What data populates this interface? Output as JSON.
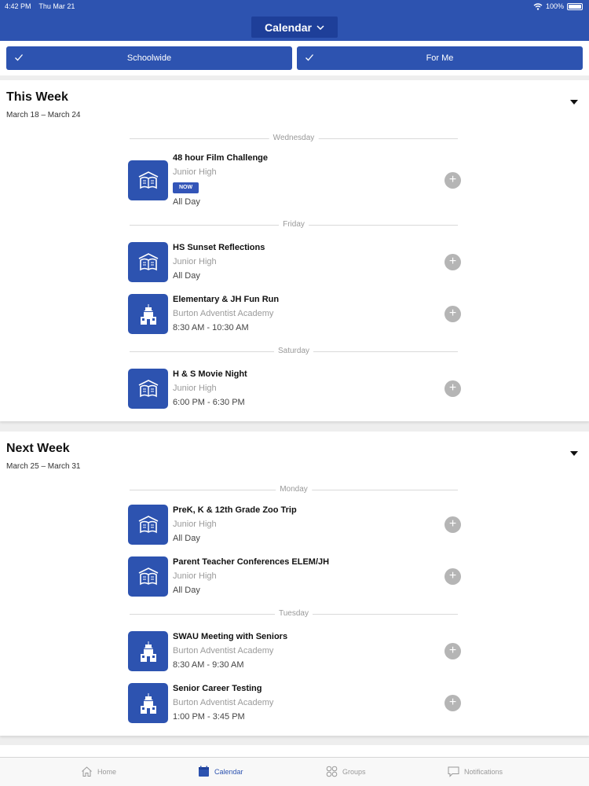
{
  "status_bar": {
    "time": "4:42 PM",
    "date": "Thu Mar 21",
    "battery": "100%",
    "battery_level": 1.0
  },
  "header": {
    "title": "Calendar"
  },
  "filters": [
    {
      "label": "Schoolwide",
      "checked": true
    },
    {
      "label": "For Me",
      "checked": true
    }
  ],
  "sections": [
    {
      "title": "This Week",
      "range": "March 18 – March 24",
      "days": [
        {
          "label": "Wednesday",
          "events": [
            {
              "title": "48 hour Film Challenge",
              "group": "Junior High",
              "badge": "NOW",
              "time": "All Day",
              "icon": "book-icon"
            }
          ]
        },
        {
          "label": "Friday",
          "events": [
            {
              "title": "HS Sunset Reflections",
              "group": "Junior High",
              "time": "All Day",
              "icon": "book-icon"
            },
            {
              "title": "Elementary & JH Fun Run",
              "group": "Burton Adventist Academy",
              "time": "8:30 AM - 10:30 AM",
              "icon": "school-building-icon"
            }
          ]
        },
        {
          "label": "Saturday",
          "events": [
            {
              "title": "H & S Movie Night",
              "group": "Junior High",
              "time": "6:00 PM - 6:30 PM",
              "icon": "book-icon"
            }
          ]
        }
      ]
    },
    {
      "title": "Next Week",
      "range": "March 25 – March 31",
      "days": [
        {
          "label": "Monday",
          "events": [
            {
              "title": "PreK, K & 12th Grade Zoo Trip",
              "group": "Junior High",
              "time": "All Day",
              "icon": "book-icon"
            },
            {
              "title": "Parent Teacher Conferences ELEM/JH",
              "group": "Junior High",
              "time": "All Day",
              "icon": "book-icon"
            }
          ]
        },
        {
          "label": "Tuesday",
          "events": [
            {
              "title": "SWAU Meeting with Seniors",
              "group": "Burton Adventist Academy",
              "time": "8:30 AM - 9:30 AM",
              "icon": "school-building-icon"
            },
            {
              "title": "Senior Career Testing",
              "group": "Burton Adventist Academy",
              "time": "1:00 PM - 3:45 PM",
              "icon": "school-building-icon"
            }
          ]
        }
      ]
    }
  ],
  "tab_bar": [
    {
      "label": "Home",
      "icon": "home-icon",
      "active": false
    },
    {
      "label": "Calendar",
      "icon": "calendar-icon",
      "active": true
    },
    {
      "label": "Groups",
      "icon": "groups-icon",
      "active": false
    },
    {
      "label": "Notifications",
      "icon": "chat-bubble-icon",
      "active": false
    }
  ],
  "colors": {
    "brand": "#2d53b0",
    "brand_dark": "#1e3f99",
    "add_button": "#b5b5b5",
    "muted_text": "#9a9a9a",
    "background": "#eeeeee"
  },
  "add_symbol": "+"
}
